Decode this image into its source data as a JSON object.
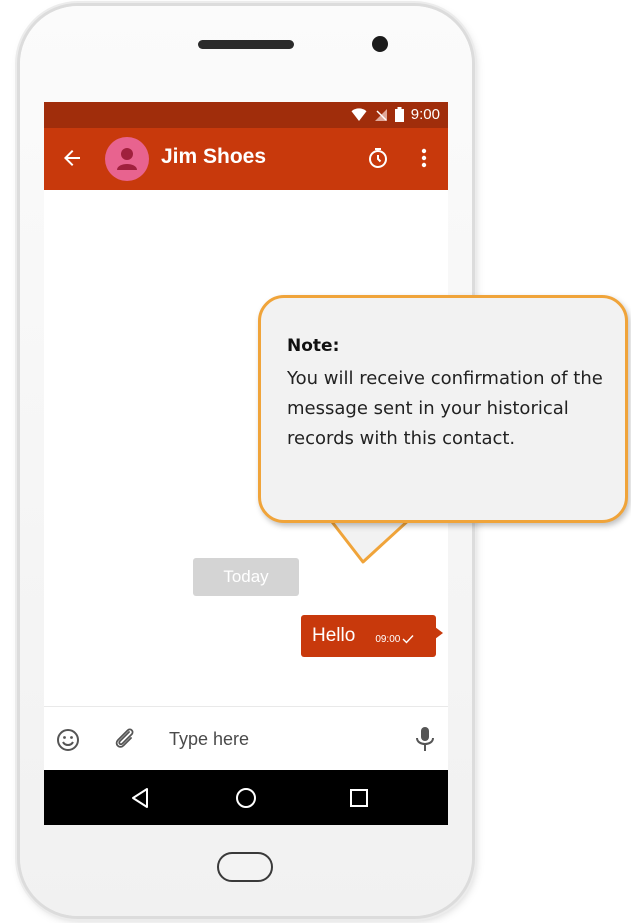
{
  "status_bar": {
    "time": "9:00",
    "icons": [
      "wifi-icon",
      "no-signal-icon",
      "battery-icon"
    ]
  },
  "app_bar": {
    "contact_name": "Jim Shoes",
    "icons": [
      "back-arrow-icon",
      "avatar-person-icon",
      "timer-icon",
      "more-vert-icon"
    ]
  },
  "conversation": {
    "date_chip": "Today",
    "messages": [
      {
        "text": "Hello",
        "time": "09:00",
        "status": "sent"
      }
    ]
  },
  "composer": {
    "placeholder": "Type here",
    "value": "",
    "icons": [
      "emoji-icon",
      "attach-icon",
      "mic-icon"
    ]
  },
  "nav_bar": {
    "icons": [
      "back-triangle-icon",
      "home-circle-icon",
      "recents-square-icon"
    ]
  },
  "callout": {
    "title": "Note:",
    "body": "You will receive confirmation of the message sent in your historical records with this contact."
  },
  "colors": {
    "status_bar": "#a02d0b",
    "app_bar": "#c8390c",
    "bubble": "#c8390c",
    "avatar": "#e8638f",
    "date_chip": "#d4d4d4",
    "callout_border": "#f0a43a",
    "callout_fill": "#f2f2f2"
  }
}
